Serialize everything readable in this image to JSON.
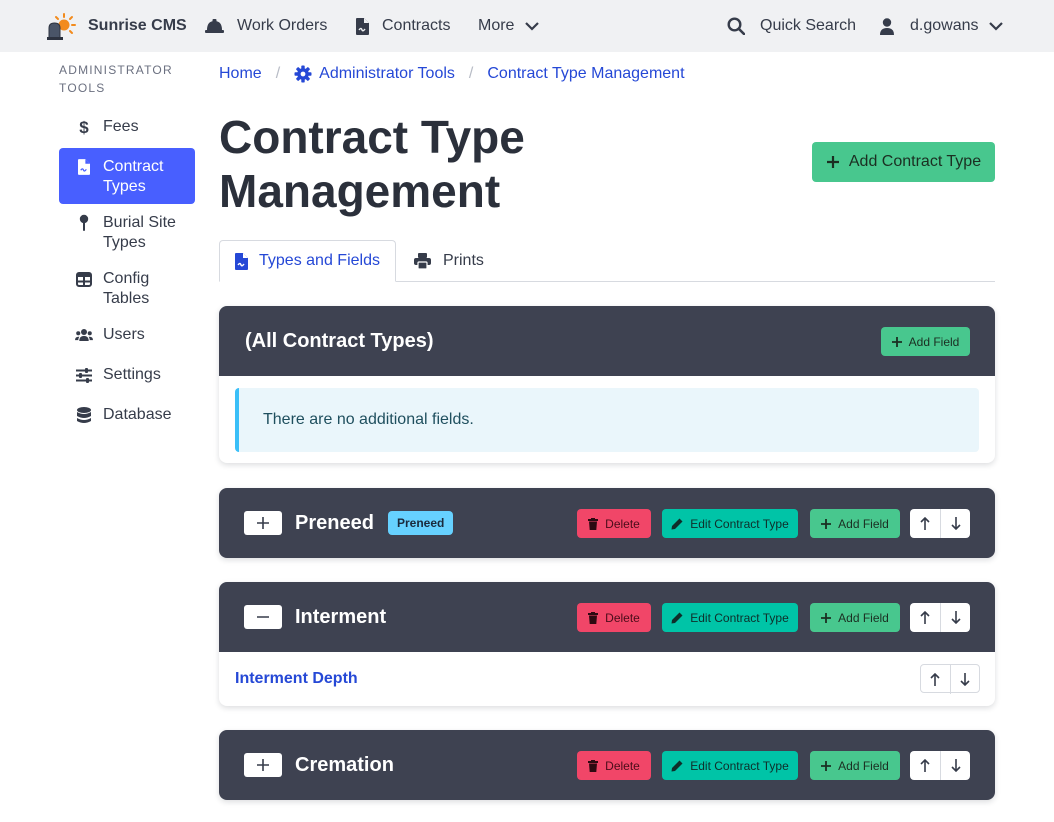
{
  "navbar": {
    "brand": "Sunrise CMS",
    "work_orders": "Work Orders",
    "contracts": "Contracts",
    "more": "More",
    "quick_search": "Quick Search",
    "user": "d.gowans"
  },
  "sidebar": {
    "label": "Administrator Tools",
    "items": [
      {
        "label": "Fees"
      },
      {
        "label": "Contract Types"
      },
      {
        "label": "Burial Site Types"
      },
      {
        "label": "Config Tables"
      },
      {
        "label": "Users"
      },
      {
        "label": "Settings"
      },
      {
        "label": "Database"
      }
    ]
  },
  "breadcrumb": [
    "Home",
    "Administrator Tools",
    "Contract Type Management"
  ],
  "page": {
    "title": "Contract Type Management",
    "add_button": "Add Contract Type"
  },
  "tabs": [
    "Types and Fields",
    "Prints"
  ],
  "panels": {
    "all": {
      "title": "(All Contract Types)",
      "add_field": "Add Field",
      "empty": "There are no additional fields."
    },
    "buttons": {
      "delete": "Delete",
      "edit": "Edit Contract Type",
      "add_field": "Add Field"
    },
    "types": [
      {
        "name": "Preneed",
        "tag": "Preneed",
        "expanded": false
      },
      {
        "name": "Interment",
        "expanded": true,
        "fields": [
          "Interment Depth"
        ]
      },
      {
        "name": "Cremation",
        "expanded": false
      }
    ]
  },
  "colors": {
    "primary": "#485fff",
    "link": "#2548d6",
    "success": "#48c78e",
    "danger": "#f14668",
    "teal": "#00c4a7",
    "info_tag": "#66d1ff",
    "panel_header": "#3e4251",
    "navbar_bg": "#f0f1f3"
  },
  "icons": {
    "brand": "sunrise-logo-icon",
    "work_orders": "hard-hat-icon",
    "contracts": "file-contract-icon",
    "search": "search-icon",
    "user": "user-icon"
  }
}
